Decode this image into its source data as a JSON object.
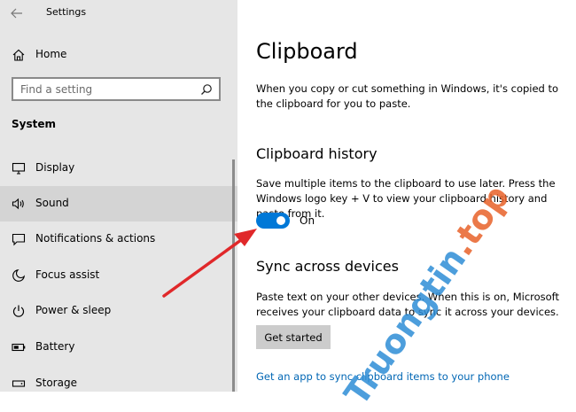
{
  "window": {
    "title": "Settings"
  },
  "sidebar": {
    "home_label": "Home",
    "search_placeholder": "Find a setting",
    "section_label": "System",
    "items": [
      {
        "label": "Display",
        "icon": "monitor-icon"
      },
      {
        "label": "Sound",
        "icon": "speaker-icon",
        "active": true
      },
      {
        "label": "Notifications & actions",
        "icon": "notification-icon"
      },
      {
        "label": "Focus assist",
        "icon": "moon-icon"
      },
      {
        "label": "Power & sleep",
        "icon": "power-icon"
      },
      {
        "label": "Battery",
        "icon": "battery-icon"
      },
      {
        "label": "Storage",
        "icon": "storage-icon"
      }
    ]
  },
  "main": {
    "title": "Clipboard",
    "intro": "When you copy or cut something in Windows, it's copied to the clipboard for you to paste.",
    "history": {
      "heading": "Clipboard history",
      "description": "Save multiple items to the clipboard to use later. Press the Windows logo key + V to view your clipboard history and paste from it.",
      "toggle_state": "On",
      "toggle_on": true
    },
    "sync": {
      "heading": "Sync across devices",
      "description": "Paste text on your other devices. When this is on, Microsoft receives your clipboard data to sync it across your devices.",
      "button_label": "Get started"
    },
    "link_text": "Get an app to sync clipboard items to your phone"
  },
  "watermark": {
    "part1": "Truongtin",
    "part2": ".top"
  },
  "colors": {
    "accent": "#0078d7",
    "link": "#0066b4",
    "arrow": "#e0282a"
  }
}
